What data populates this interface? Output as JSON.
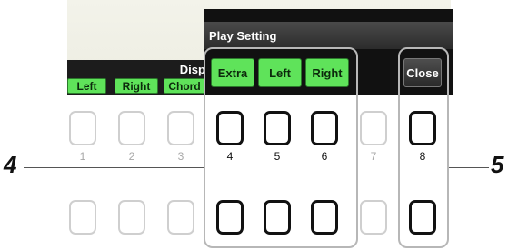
{
  "display": {
    "label": "Display",
    "buttons": [
      "Left",
      "Right",
      "Chord"
    ]
  },
  "popup": {
    "title": "Play Setting",
    "buttons": [
      "Extra",
      "Left",
      "Right"
    ],
    "close_label": "Close"
  },
  "panel_buttons": {
    "numbers": [
      "1",
      "2",
      "3",
      "4",
      "5",
      "6",
      "7",
      "8"
    ]
  },
  "callouts": {
    "left": "4",
    "right": "5"
  },
  "colors": {
    "green": "#5fe35a",
    "popup_bg": "#111111",
    "screen_bg": "#f0f0e6"
  }
}
